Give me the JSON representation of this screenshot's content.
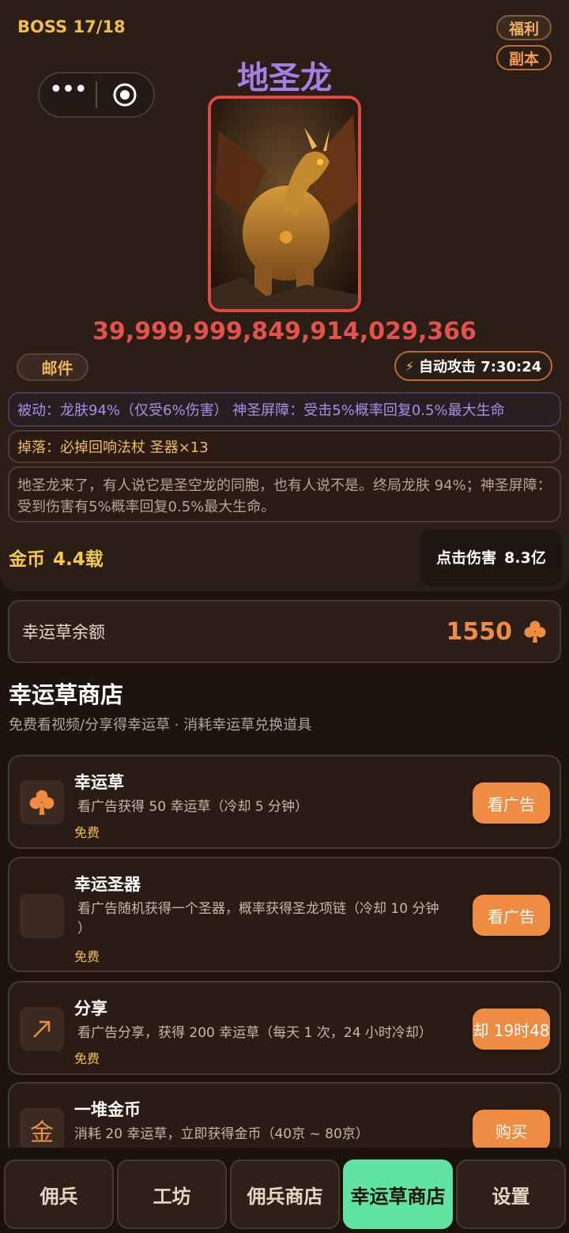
{
  "boss": {
    "counter": "BOSS 17/18",
    "name": "地圣龙",
    "hp": "39,999,999,849,914,029,366",
    "welfare_label": "福利",
    "dungeon_label": "副本",
    "mail_label": "邮件",
    "auto_attack_label": "自动攻击 7:30:24",
    "passive": "被动：龙肤94%（仅受6%伤害）   神圣屏障：受击5%概率回复0.5%最大生命",
    "drop": "掉落：必掉回响法杖  圣器×13",
    "description": "地圣龙来了，有人说它是圣空龙的同胞，也有人说不是。终局龙肤 94%；神圣屏障：受到伤害有5%概率回复0.5%最大生命。",
    "gold_label": "金币",
    "gold_value": "4.4载",
    "click_damage_label": "点击伤害",
    "click_damage_value": "8.3亿"
  },
  "balance": {
    "label": "幸运草余额",
    "value": "1550",
    "icon": "clover-icon"
  },
  "shop": {
    "title": "幸运草商店",
    "subtitle": "免费看视频/分享得幸运草 · 消耗幸运草兑换道具",
    "items": [
      {
        "icon": "clover-icon",
        "title": "幸运草",
        "desc": "看广告获得 50 幸运草（冷却 5 分钟）",
        "price": "免费",
        "button": "看广告"
      },
      {
        "icon": "blank-icon",
        "title": "幸运圣器",
        "desc": "看广告随机获得一个圣器，概率获得圣龙项链（冷却 10 分钟",
        "desc2": "）",
        "price": "免费",
        "button": "看广告"
      },
      {
        "icon": "share-arrow-icon",
        "title": "分享",
        "desc": "看广告分享，获得 200 幸运草（每天 1 次，24 小时冷却）",
        "price": "免费",
        "button": "却 19时48"
      },
      {
        "icon": "gold-char-icon",
        "icon_text": "金",
        "title": "一堆金币",
        "desc": "消耗 20 幸运草，立即获得金币（40京 ~ 80京）",
        "button": "购买"
      }
    ]
  },
  "nav": {
    "tabs": [
      "佣兵",
      "工坊",
      "佣兵商店",
      "幸运草商店",
      "设置"
    ],
    "active_index": 3
  },
  "colors": {
    "accent": "#ef8c43",
    "active_tab": "#5fe3a0",
    "boss_name": "#a57ee6",
    "hp": "#e4524c",
    "gold": "#f2c94c"
  }
}
